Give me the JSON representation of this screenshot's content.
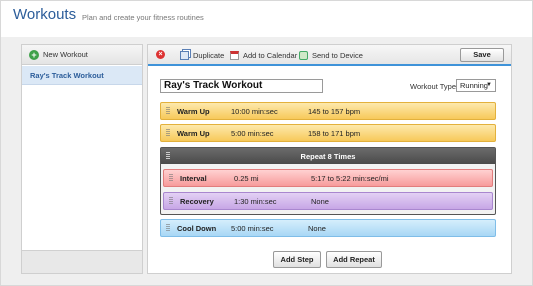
{
  "header": {
    "title": "Workouts",
    "subtitle": "Plan and create your fitness routines"
  },
  "sidebar": {
    "new_workout_label": "New Workout",
    "items": [
      {
        "label": "Ray's Track Workout",
        "selected": true
      }
    ]
  },
  "toolbar": {
    "duplicate_label": "Duplicate",
    "add_calendar_label": "Add to Calendar",
    "send_device_label": "Send to Device",
    "save_label": "Save"
  },
  "workout": {
    "name": "Ray's Track Workout",
    "type_label": "Workout Type",
    "type_value": "Running"
  },
  "steps": [
    {
      "name": "Warm Up",
      "duration": "10:00 min:sec",
      "target": "145 to 157 bpm",
      "color": "#f7c95a"
    },
    {
      "name": "Warm Up",
      "duration": "5:00 min:sec",
      "target": "158 to 171 bpm",
      "color": "#f7c95a"
    }
  ],
  "repeat": {
    "label": "Repeat 8 Times",
    "steps": [
      {
        "name": "Interval",
        "duration": "0.25 mi",
        "target": "5:17 to 5:22 min:sec/mi",
        "color": "#f79b9b"
      },
      {
        "name": "Recovery",
        "duration": "1:30 min:sec",
        "target": "None",
        "color": "#c7a6e6"
      }
    ]
  },
  "cooldown": {
    "name": "Cool Down",
    "duration": "5:00 min:sec",
    "target": "None",
    "color": "#a8d7f5"
  },
  "actions": {
    "add_step_label": "Add Step",
    "add_repeat_label": "Add Repeat"
  },
  "colors": {
    "accent": "#3f93d9",
    "title": "#2c5d9a",
    "selected_bg": "#dbe8f6"
  }
}
